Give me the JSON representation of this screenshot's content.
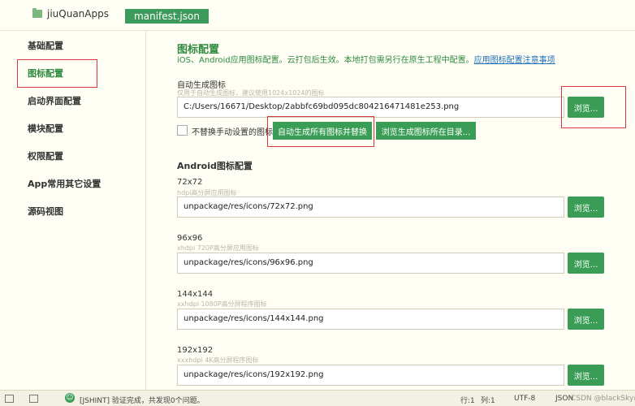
{
  "tabs": {
    "project": "jiuQuanApps",
    "file": "manifest.json"
  },
  "sidebar": {
    "items": [
      {
        "label": "基础配置"
      },
      {
        "label": "图标配置",
        "active": true
      },
      {
        "label": "启动界面配置"
      },
      {
        "label": "模块配置"
      },
      {
        "label": "权限配置"
      },
      {
        "label": "App常用其它设置"
      },
      {
        "label": "源码视图"
      }
    ]
  },
  "main": {
    "title": "图标配置",
    "description": "iOS、Android应用图标配置。云打包后生效。本地打包需另行在原生工程中配置。",
    "description_link": "应用图标配置注意事项",
    "auto_gen": {
      "label": "自动生成图标",
      "hint": "仅用于自动生成图标，建议使用1024x1024的图标",
      "value": "C:/Users/16671/Desktop/2abbfc69bd095dc804216471481e253.png",
      "browse": "浏览..."
    },
    "replace_checkbox_label": "不替换手动设置的图标",
    "generate_button": "自动生成所有图标并替换",
    "browse_dir_button": "浏览生成图标所在目录...",
    "android_title": "Android图标配置",
    "icons": [
      {
        "size": "72x72",
        "hint": "hdpi高分屏应用图标",
        "value": "unpackage/res/icons/72x72.png",
        "browse": "浏览..."
      },
      {
        "size": "96x96",
        "hint": "xhdpi 720P高分屏应用图标",
        "value": "unpackage/res/icons/96x96.png",
        "browse": "浏览..."
      },
      {
        "size": "144x144",
        "hint": "xxhdpi 1080P高分屏程序图标",
        "value": "unpackage/res/icons/144x144.png",
        "browse": "浏览..."
      },
      {
        "size": "192x192",
        "hint": "xxxhdpi 4K高分屏程序图标",
        "value": "unpackage/res/icons/192x192.png",
        "browse": "浏览..."
      }
    ]
  },
  "statusbar": {
    "message": "[JSHINT] 验证完成，共发现0个问题。",
    "line": "行:1",
    "col": "列:1",
    "encoding": "UTF-8",
    "language": "JSON",
    "watermark": "CSDN @blackSky@pen"
  },
  "colors": {
    "accent": "#3a9d55",
    "highlight": "#d9363e",
    "background": "#fffef5"
  }
}
